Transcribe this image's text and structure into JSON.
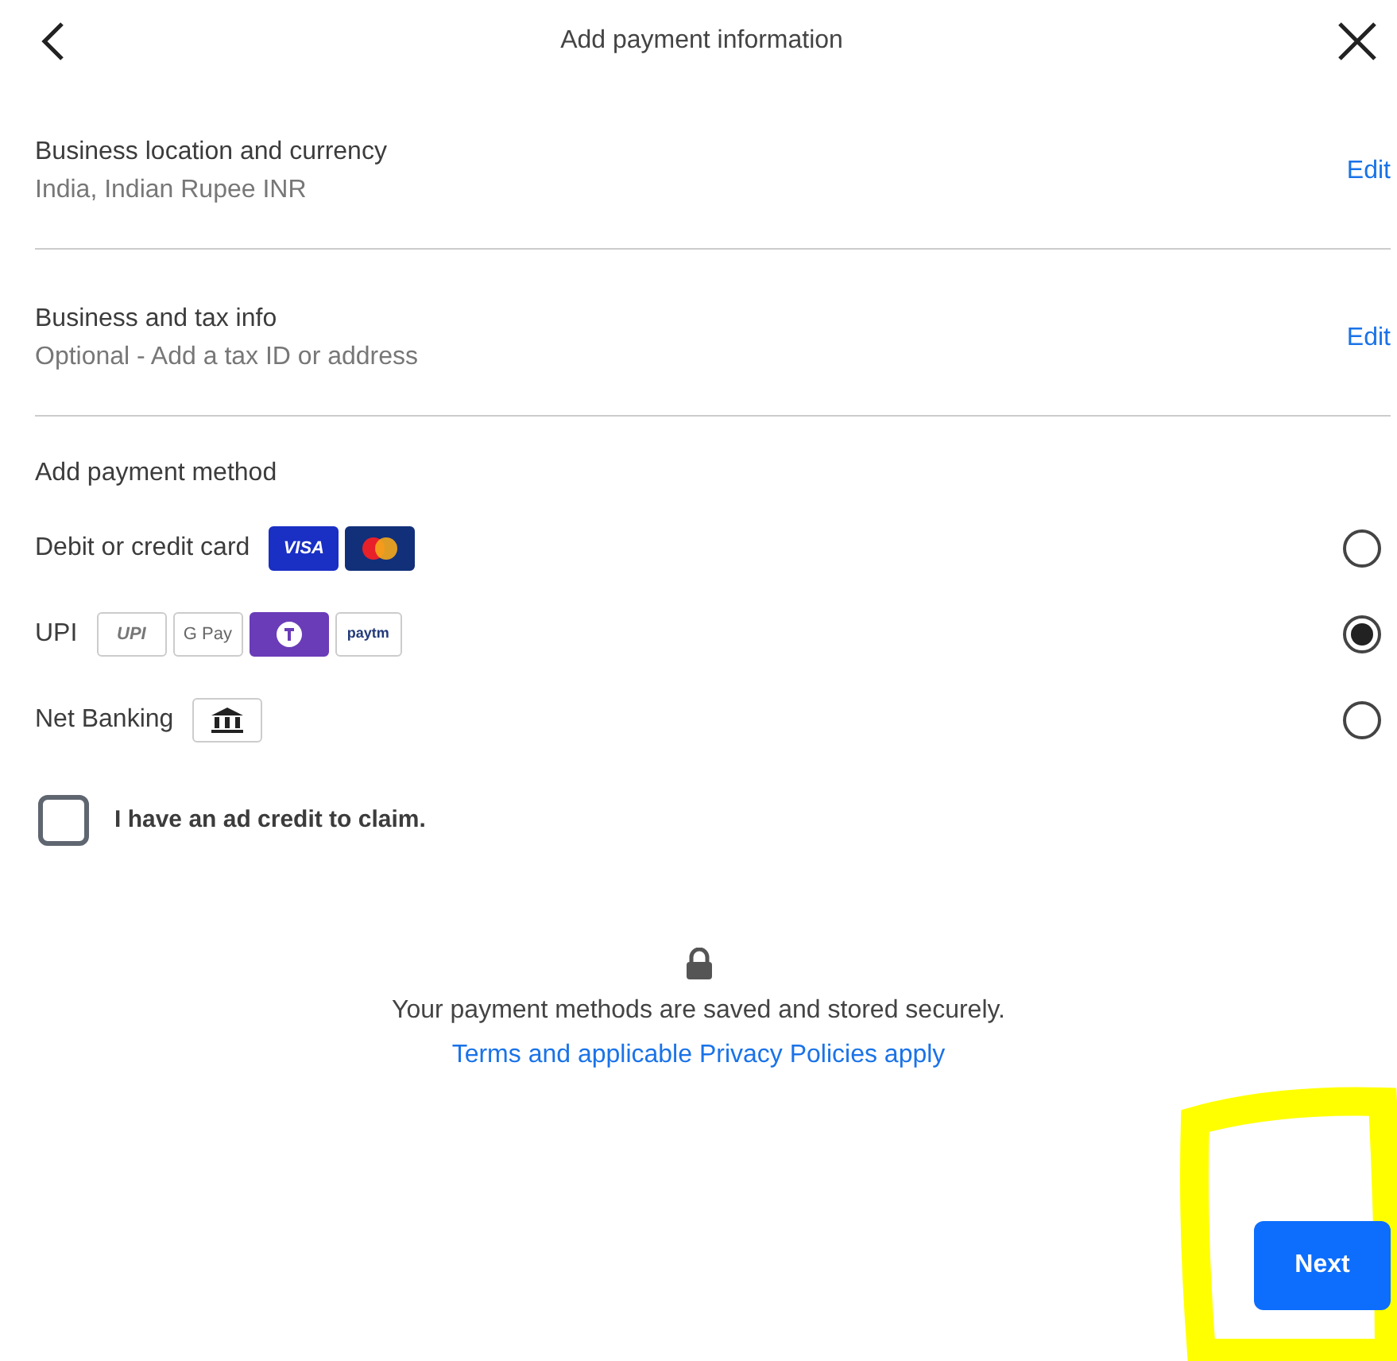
{
  "header": {
    "title": "Add payment information"
  },
  "sections": [
    {
      "title": "Business location and currency",
      "subtitle": "India, Indian Rupee INR",
      "action": "Edit"
    },
    {
      "title": "Business and tax info",
      "subtitle": "Optional - Add a tax ID or address",
      "action": "Edit"
    }
  ],
  "payment": {
    "heading": "Add payment method",
    "methods": [
      {
        "label": "Debit or credit card",
        "selected": false,
        "logos": [
          {
            "kind": "visa",
            "text": "VISA"
          },
          {
            "kind": "mastercard"
          }
        ]
      },
      {
        "label": "UPI",
        "selected": true,
        "logos": [
          {
            "kind": "upi",
            "text": "UPI"
          },
          {
            "kind": "gpay",
            "text": "G Pay"
          },
          {
            "kind": "phonepe"
          },
          {
            "kind": "paytm",
            "text": "paytm"
          }
        ]
      },
      {
        "label": "Net Banking",
        "selected": false,
        "logos": [
          {
            "kind": "bank"
          }
        ]
      }
    ]
  },
  "ad_credit": {
    "label": "I have an ad credit to claim.",
    "checked": false
  },
  "footer": {
    "note": "Your payment methods are saved and stored securely.",
    "link": "Terms and applicable Privacy Policies apply"
  },
  "next_button": "Next"
}
